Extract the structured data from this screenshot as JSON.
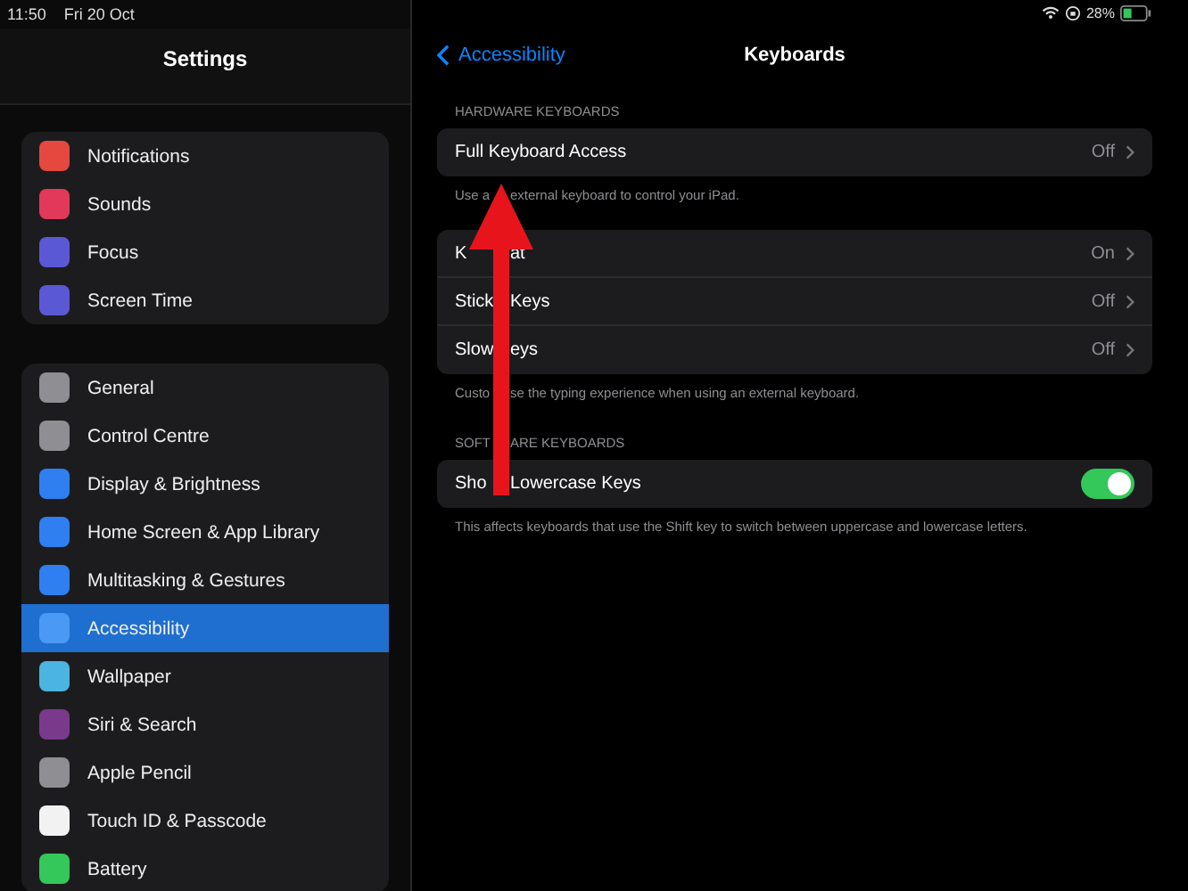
{
  "status_bar": {
    "time": "11:50",
    "date": "Fri 20 Oct",
    "battery": "28%"
  },
  "sidebar": {
    "title": "Settings",
    "groups": [
      {
        "items": [
          {
            "label": "Notifications",
            "color": "#e5483f",
            "selected": false
          },
          {
            "label": "Sounds",
            "color": "#e2385a",
            "selected": false
          },
          {
            "label": "Focus",
            "color": "#5b58d6",
            "selected": false
          },
          {
            "label": "Screen Time",
            "color": "#5b58d6",
            "selected": false
          }
        ]
      },
      {
        "items": [
          {
            "label": "General",
            "color": "#8e8e93",
            "selected": false
          },
          {
            "label": "Control Centre",
            "color": "#8e8e93",
            "selected": false
          },
          {
            "label": "Display & Brightness",
            "color": "#2f7ff0",
            "selected": false
          },
          {
            "label": "Home Screen & App Library",
            "color": "#2f7ff0",
            "selected": false
          },
          {
            "label": "Multitasking & Gestures",
            "color": "#2f7ff0",
            "selected": false
          },
          {
            "label": "Accessibility",
            "color": "#4a9af5",
            "selected": true
          },
          {
            "label": "Wallpaper",
            "color": "#4cb4e0",
            "selected": false
          },
          {
            "label": "Siri & Search",
            "color": "#7a3a8c",
            "selected": false
          },
          {
            "label": "Apple Pencil",
            "color": "#8e8e93",
            "selected": false
          },
          {
            "label": "Touch ID & Passcode",
            "color": "#f2f2f2",
            "selected": false
          },
          {
            "label": "Battery",
            "color": "#34c759",
            "selected": false
          }
        ]
      }
    ]
  },
  "nav": {
    "back": "Accessibility",
    "title": "Keyboards"
  },
  "sections": [
    {
      "header": [
        "HARDWARE KEYBOARDS"
      ],
      "rows": [
        {
          "kind": "link",
          "label": [
            "Full Keyboard Access"
          ],
          "value": "Off"
        }
      ],
      "footer": [
        "Use a",
        "external keyboard to control your iPad."
      ]
    },
    {
      "rows": [
        {
          "kind": "link",
          "label": [
            "K",
            "at"
          ],
          "value": "On"
        },
        {
          "kind": "link",
          "label": [
            "Stick",
            "Keys"
          ],
          "value": "Off"
        },
        {
          "kind": "link",
          "label": [
            "Slow",
            "eys"
          ],
          "value": "Off"
        }
      ],
      "footer": [
        "Custo",
        "se the typing experience when using an external keyboard."
      ]
    },
    {
      "header": [
        "SOFT",
        "ARE KEYBOARDS"
      ],
      "rows": [
        {
          "kind": "toggle",
          "label": [
            "Sho",
            "Lowercase Keys"
          ],
          "on": true
        }
      ],
      "footer": [
        "This affects keyboards that use the Shift key to switch between uppercase and lowercase letters."
      ]
    }
  ]
}
